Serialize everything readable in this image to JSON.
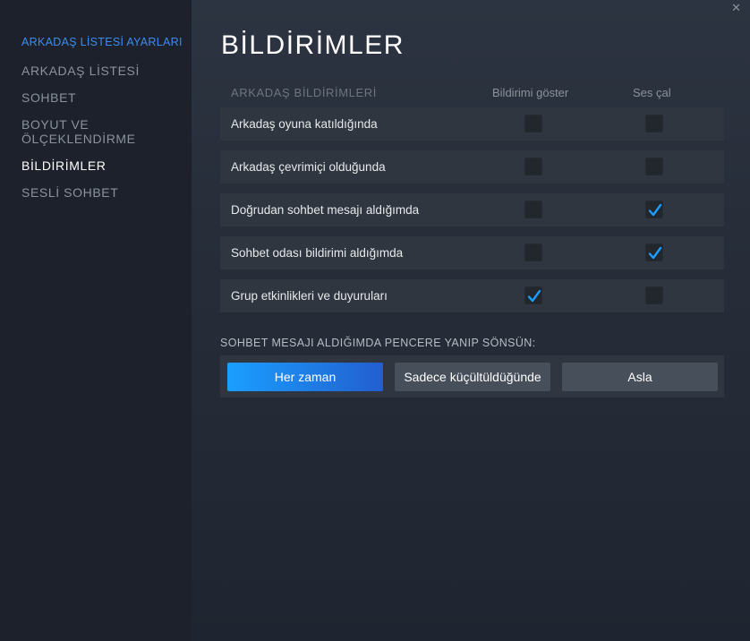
{
  "sidebar": {
    "header": "ARKADAŞ LİSTESİ AYARLARI",
    "items": [
      {
        "label": "ARKADAŞ LİSTESİ",
        "active": false
      },
      {
        "label": "SOHBET",
        "active": false
      },
      {
        "label": "BOYUT VE ÖLÇEKLENDİRME",
        "active": false
      },
      {
        "label": "BİLDİRİMLER",
        "active": true
      },
      {
        "label": "SESLİ SOHBET",
        "active": false
      }
    ]
  },
  "window": {
    "close_glyph": "✕"
  },
  "main": {
    "title": "BİLDİRİMLER",
    "group_label": "ARKADAŞ BİLDİRİMLERİ",
    "column_show": "Bildirimi göster",
    "column_sound": "Ses çal",
    "rows": [
      {
        "label": "Arkadaş oyuna katıldığında",
        "show": false,
        "sound": false
      },
      {
        "label": "Arkadaş çevrimiçi olduğunda",
        "show": false,
        "sound": false
      },
      {
        "label": "Doğrudan sohbet mesajı aldığımda",
        "show": false,
        "sound": true
      },
      {
        "label": "Sohbet odası bildirimi aldığımda",
        "show": false,
        "sound": true
      },
      {
        "label": "Grup etkinlikleri ve duyuruları",
        "show": true,
        "sound": false
      }
    ],
    "flash_section_label": "SOHBET MESAJI ALDIĞIMDA PENCERE YANIP SÖNSÜN:",
    "flash_options": [
      {
        "label": "Her zaman",
        "selected": true
      },
      {
        "label": "Sadece küçültüldüğünde",
        "selected": false
      },
      {
        "label": "Asla",
        "selected": false
      }
    ]
  },
  "colors": {
    "accent": "#1a9fff",
    "checkmark": "#1a9fff",
    "sidebar_header": "#3d8cf0"
  },
  "icons": {
    "check": "checkmark-icon",
    "close": "close-icon"
  }
}
